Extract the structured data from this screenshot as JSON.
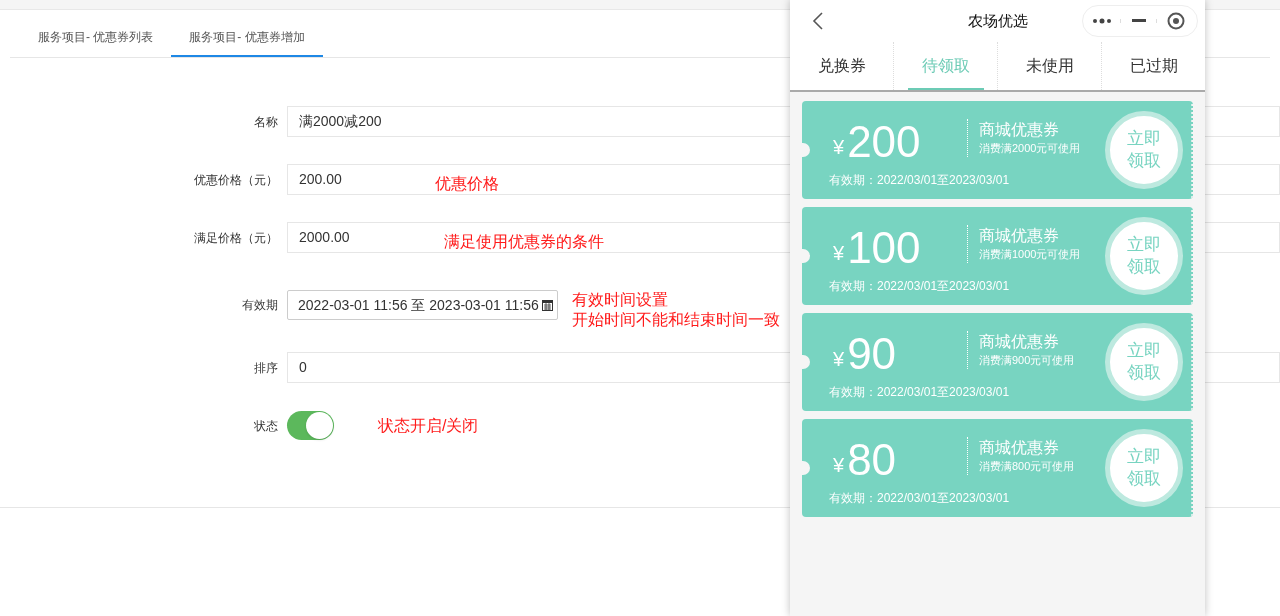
{
  "admin_tabs": [
    {
      "label": "服务项目- 优惠券列表",
      "selected": false
    },
    {
      "label": "服务项目- 优惠券增加",
      "selected": true
    }
  ],
  "form": {
    "fields": [
      {
        "kind": "text",
        "label": "名称",
        "value": "满2000减200"
      },
      {
        "kind": "text",
        "label": "优惠价格（元）",
        "value": "200.00",
        "annotation": "优惠价格"
      },
      {
        "kind": "text",
        "label": "满足价格（元）",
        "value": "2000.00",
        "annotation": "满足使用优惠券的条件"
      },
      {
        "kind": "daterange",
        "label": "有效期",
        "value": "2022-03-01 11:56 至 2023-03-01 11:56",
        "annotation_lines": [
          "有效时间设置",
          "开始时间不能和结束时间一致"
        ]
      },
      {
        "kind": "text",
        "label": "排序",
        "value": "0"
      },
      {
        "kind": "toggle",
        "label": "状态",
        "on": true,
        "annotation": "状态开启/关闭"
      }
    ]
  },
  "phone": {
    "title": "农场优选",
    "tabs": [
      {
        "label": "兑换券",
        "selected": false
      },
      {
        "label": "待领取",
        "selected": true
      },
      {
        "label": "未使用",
        "selected": false
      },
      {
        "label": "已过期",
        "selected": false
      }
    ],
    "coupons": [
      {
        "currency": "¥",
        "amount": "200",
        "title": "商城优惠券",
        "condition": "消费满2000元可使用",
        "validity": "有效期：2022/03/01至2023/03/01",
        "button": "立即领取"
      },
      {
        "currency": "¥",
        "amount": "100",
        "title": "商城优惠券",
        "condition": "消费满1000元可使用",
        "validity": "有效期：2022/03/01至2023/03/01",
        "button": "立即领取"
      },
      {
        "currency": "¥",
        "amount": "90",
        "title": "商城优惠券",
        "condition": "消费满900元可使用",
        "validity": "有效期：2022/03/01至2023/03/01",
        "button": "立即领取"
      },
      {
        "currency": "¥",
        "amount": "80",
        "title": "商城优惠券",
        "condition": "消费满800元可使用",
        "validity": "有效期：2022/03/01至2023/03/01",
        "button": "立即领取"
      }
    ]
  }
}
